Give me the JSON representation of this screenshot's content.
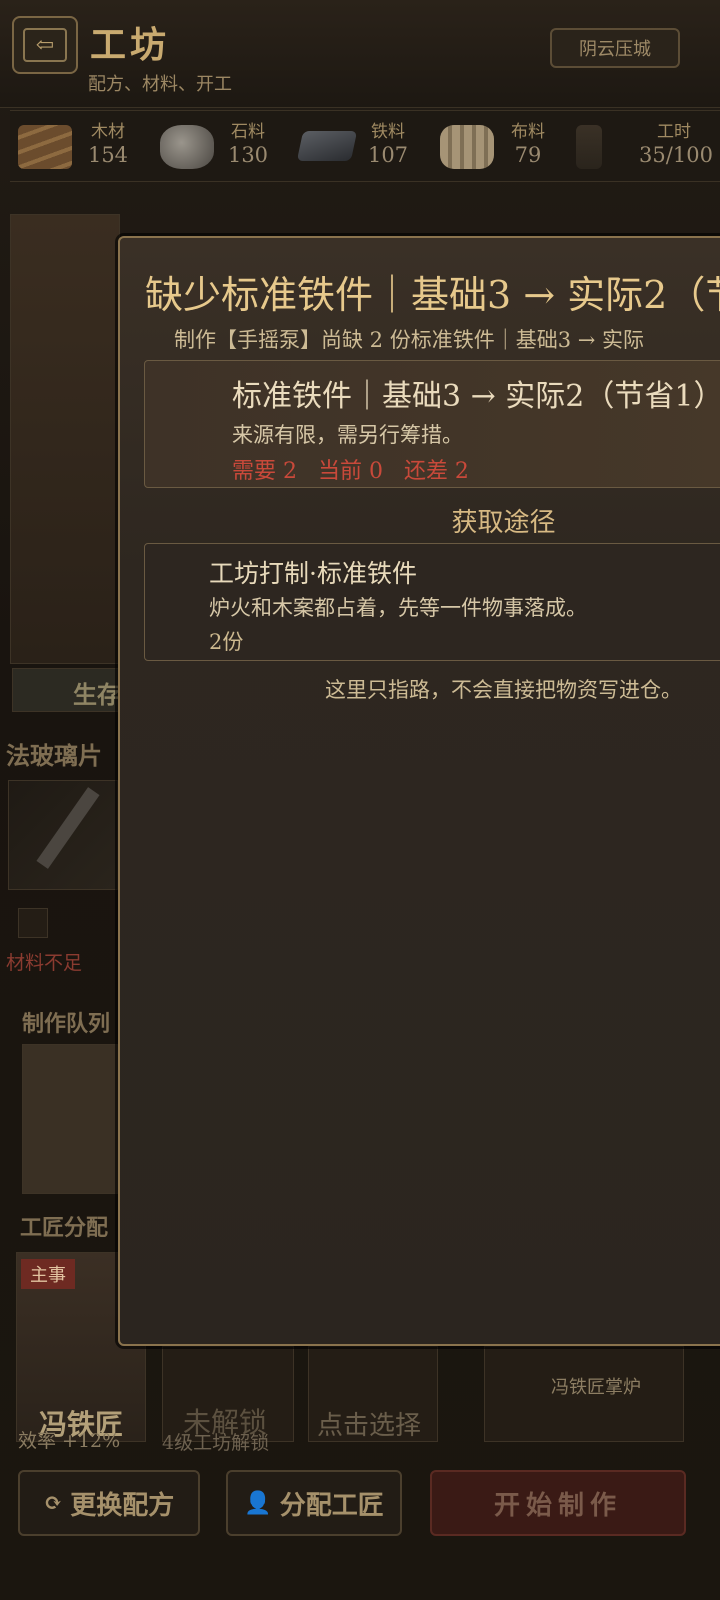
{
  "header": {
    "title": "工坊",
    "subtitle": "配方、材料、开工",
    "city_button": "阴云压城"
  },
  "resources": [
    {
      "label": "木材",
      "value": "154",
      "icon": "wood-icon"
    },
    {
      "label": "石料",
      "value": "130",
      "icon": "stone-icon"
    },
    {
      "label": "铁料",
      "value": "107",
      "icon": "iron-icon"
    },
    {
      "label": "布料",
      "value": "79",
      "icon": "cloth-icon"
    },
    {
      "label": "工时",
      "value": "35/100",
      "icon": "hourglass-icon"
    }
  ],
  "background": {
    "tab_partial": "生存",
    "recipe_partial": "法玻璃片",
    "material_warning": "材料不足",
    "queue_label": "制作队列",
    "artisan_label": "工匠分配",
    "artisans": [
      {
        "badge": "主事",
        "name": "冯铁匠",
        "note": "效率 +12%"
      },
      {
        "name": "未解锁",
        "note": "4级工坊解锁"
      },
      {
        "name": "点击选择"
      }
    ],
    "forge_label": "冯铁匠掌炉",
    "buttons": {
      "change_recipe": "更换配方",
      "assign_artisan": "分配工匠",
      "start": "开始制作"
    }
  },
  "modal": {
    "title": "缺少标准铁件｜基础3 → 实际2（节",
    "subtitle": "制作【手摇泵】尚缺 2 份标准铁件｜基础3 → 实际",
    "item": {
      "title": "标准铁件｜基础3 → 实际2（节省1）",
      "desc": "来源有限，需另行筹措。",
      "need": "需要 2   当前 0   还差 2"
    },
    "section_title": "获取途径",
    "route": {
      "title": "工坊打制·标准铁件",
      "desc": "炉火和木案都占着，先等一件物事落成。",
      "qty": "2份"
    },
    "hint": "这里只指路，不会直接把物资写进仓。"
  },
  "colors": {
    "accent": "#e7c98c",
    "warning": "#c9493a",
    "border": "#8a734d"
  }
}
